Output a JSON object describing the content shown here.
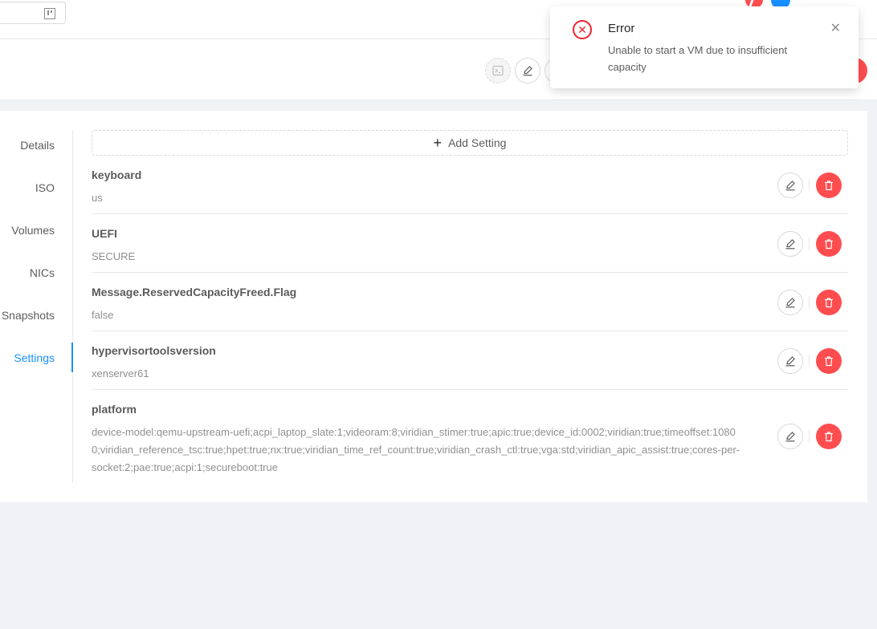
{
  "header": {
    "search_icon": "kanban-icon",
    "actions": [
      {
        "name": "console-icon"
      },
      {
        "name": "edit-icon"
      },
      {
        "name": "delete-icon"
      }
    ]
  },
  "sidebar": {
    "tabs": [
      {
        "label": "Details"
      },
      {
        "label": "ISO"
      },
      {
        "label": "Volumes"
      },
      {
        "label": "NICs"
      },
      {
        "label": "Snapshots"
      },
      {
        "label": "Settings",
        "active": true
      }
    ]
  },
  "settings": {
    "add_label": "Add Setting",
    "items": [
      {
        "name": "keyboard",
        "value": "us"
      },
      {
        "name": "UEFI",
        "value": "SECURE"
      },
      {
        "name": "Message.ReservedCapacityFreed.Flag",
        "value": "false"
      },
      {
        "name": "hypervisortoolsversion",
        "value": "xenserver61"
      },
      {
        "name": "platform",
        "value": "device-model:qemu-upstream-uefi;acpi_laptop_slate:1;videoram:8;viridian_stimer:true;apic:true;device_id:0002;viridian:true;timeoffset:10800;viridian_reference_tsc:true;hpet:true;nx:true;viridian_time_ref_count:true;viridian_crash_ctl:true;vga:std;viridian_apic_assist:true;cores-per-socket:2;pae:true;acpi:1;secureboot:true"
      }
    ]
  },
  "notification": {
    "type": "error",
    "title": "Error",
    "description": "Unable to start a VM due to insufficient capacity",
    "icon": "close-circle-icon",
    "close_icon": "close-icon"
  },
  "colors": {
    "primary": "#1890ff",
    "danger": "#ff4d4f",
    "error": "#f5222d"
  }
}
